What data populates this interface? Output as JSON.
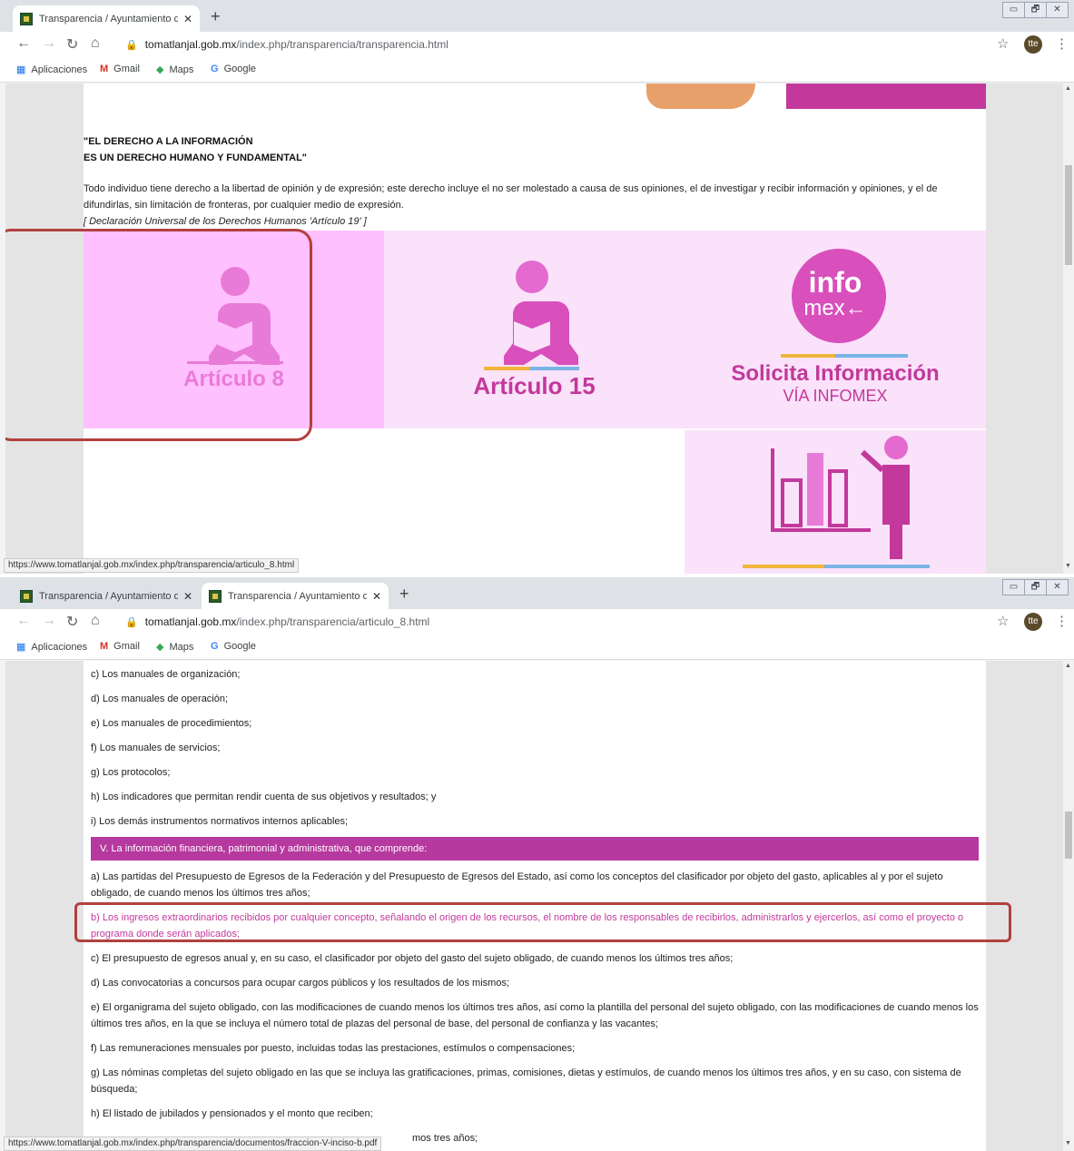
{
  "window1": {
    "tabs": [
      {
        "title": "Transparencia / Ayuntamiento de",
        "close": "✕"
      }
    ],
    "new_tab": "+",
    "url_host": "tomatlanjal.gob.mx",
    "url_path": "/index.php/transparencia/transparencia.html",
    "status_url": "https://www.tomatlanjal.gob.mx/index.php/transparencia/articulo_8.html",
    "quote_line1": "\"EL DERECHO A LA INFORMACIÓN",
    "quote_line2": "ES UN DERECHO HUMANO Y FUNDAMENTAL\"",
    "paragraph": "Todo individuo tiene derecho a la libertad de opinión y de expresión; este derecho incluye el no ser molestado a causa de sus opiniones, el de investigar y recibir información y opiniones, y el de difundirlas, sin limitación de fronteras, por cualquier medio de expresión.",
    "citation": "[ Declaración Universal de los Derechos Humanos 'Artículo 19' ]",
    "tiles": {
      "articulo8": "Artículo 8",
      "articulo15": "Artículo 15",
      "infomex_top": "info",
      "infomex_bottom": "mex←",
      "solicita": "Solicita Información",
      "via": "VÍA INFOMEX"
    }
  },
  "window2": {
    "tabs": [
      {
        "title": "Transparencia / Ayuntamiento de",
        "close": "✕"
      },
      {
        "title": "Transparencia / Ayuntamiento de",
        "close": "✕"
      }
    ],
    "new_tab": "+",
    "url_host": "tomatlanjal.gob.mx",
    "url_path": "/index.php/transparencia/articulo_8.html",
    "status_url": "https://www.tomatlanjal.gob.mx/index.php/transparencia/documentos/fraccion-V-inciso-b.pdf",
    "items_before": [
      "c) Los manuales de organización;",
      "d) Los manuales de operación;",
      "e) Los manuales de procedimientos;",
      "f) Los manuales de servicios;",
      "g) Los protocolos;",
      "h) Los indicadores que permitan rendir cuenta de sus objetivos y resultados; y",
      "i) Los demás instrumentos normativos internos aplicables;"
    ],
    "section_heading": "V. La información financiera, patrimonial y administrativa, que comprende:",
    "item_a": "a) Las partidas del Presupuesto de Egresos de la Federación y del Presupuesto de Egresos del Estado, así como los conceptos del clasificador por objeto del gasto, aplicables al y por el sujeto obligado, de cuando menos los últimos tres años;",
    "item_b": "b) Los ingresos extraordinarios recibidos por cualquier concepto, señalando el origen de los recursos, el nombre de los responsables de recibirlos, administrarlos y ejercerlos, así como el proyecto o programa donde serán aplicados;",
    "item_c": "c) El presupuesto de egresos anual y, en su caso, el clasificador por objeto del gasto del sujeto obligado, de cuando menos los últimos tres años;",
    "item_d": "d) Las convocatorias a concursos para ocupar cargos públicos y los resultados de los mismos;",
    "item_e": "e) El organigrama del sujeto obligado, con las modificaciones de cuando menos los últimos tres años, así como la plantilla del personal del sujeto obligado, con las modificaciones de cuando menos los últimos tres años, en la que se incluya el número total de plazas del personal de base, del personal de confianza y las vacantes;",
    "item_f": "f) Las remuneraciones mensuales por puesto, incluidas todas las prestaciones, estímulos o compensaciones;",
    "item_g": "g) Las nóminas completas del sujeto obligado en las que se incluya las gratificaciones, primas, comisiones, dietas y estímulos, de cuando menos los últimos tres años, y en su caso, con sistema de búsqueda;",
    "item_h": "h) El listado de jubilados y pensionados y el monto que reciben;",
    "item_i_partial": "mos tres años;"
  },
  "bookmarks": {
    "apps": "Aplicaciones",
    "gmail": "Gmail",
    "maps": "Maps",
    "google": "Google"
  },
  "window_controls": {
    "min": "▭",
    "max": "🗗",
    "close": "✕"
  },
  "nav": {
    "back": "←",
    "forward": "→",
    "reload": "↻",
    "home": "⌂",
    "star": "☆",
    "menu": "⋮",
    "avatar": "tte"
  },
  "colors": {
    "magenta": "#c2399b",
    "pink_tile": "#ffc0ff",
    "light_tile": "#fae2fa",
    "highlight": "#b0413e"
  }
}
